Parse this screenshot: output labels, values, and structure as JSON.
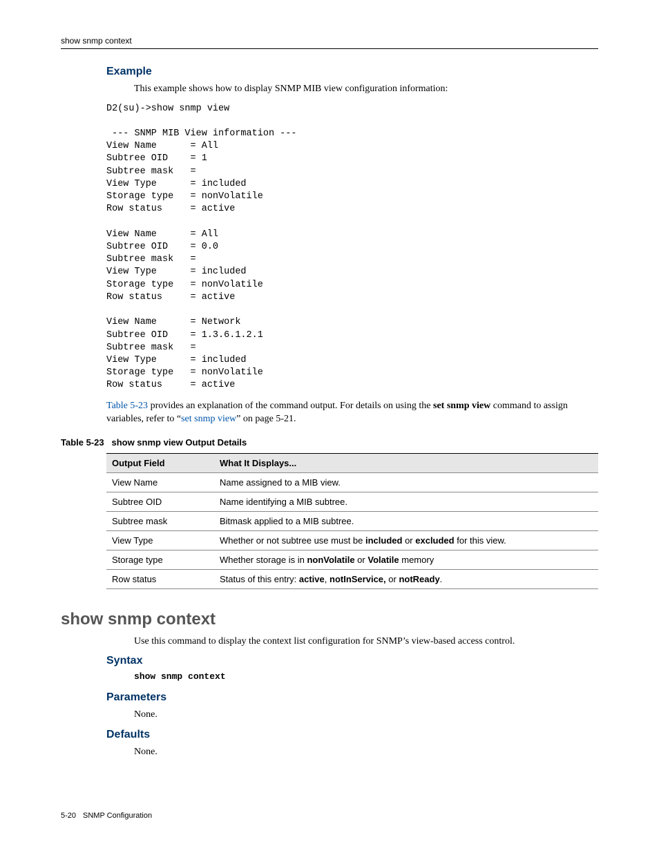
{
  "runningHead": "show snmp context",
  "sections": {
    "example": {
      "heading": "Example",
      "intro": "This example shows how to display SNMP MIB view configuration information:",
      "terminal": "D2(su)->show snmp view\n\n --- SNMP MIB View information ---\nView Name      = All\nSubtree OID    = 1\nSubtree mask   =\nView Type      = included\nStorage type   = nonVolatile\nRow status     = active\n\nView Name      = All\nSubtree OID    = 0.0\nSubtree mask   =\nView Type      = included\nStorage type   = nonVolatile\nRow status     = active\n\nView Name      = Network\nSubtree OID    = 1.3.6.1.2.1\nSubtree mask   =\nView Type      = included\nStorage type   = nonVolatile\nRow status     = active",
      "after_link_ref": "Table 5-23",
      "after_text_1": " provides an explanation of the command output. For details on using the ",
      "after_bold_1": "set snmp view",
      "after_text_2": " command to assign variables, refer to “",
      "after_link_2": "set snmp view",
      "after_text_3": "” on page 5-21."
    },
    "table": {
      "caption_label": "Table 5-23",
      "caption_title": "show snmp view Output Details",
      "head_col1": "Output Field",
      "head_col2": "What It Displays...",
      "rows": [
        {
          "field": "View Name",
          "desc_plain": "Name assigned to a MIB view."
        },
        {
          "field": "Subtree OID",
          "desc_plain": "Name identifying a MIB subtree."
        },
        {
          "field": "Subtree mask",
          "desc_plain": "Bitmask applied to a MIB subtree."
        },
        {
          "field": "View Type",
          "desc_pre": "Whether or not subtree use must be ",
          "b1": "included",
          "mid1": " or ",
          "b2": "excluded",
          "post": " for this view."
        },
        {
          "field": "Storage type",
          "desc_pre": "Whether storage is in ",
          "b1": "nonVolatile",
          "mid1": " or ",
          "b2": "Volatile",
          "post": " memory"
        },
        {
          "field": "Row status",
          "desc_pre": "Status of this entry: ",
          "b1": "active",
          "mid1": ", ",
          "b2": "notInService,",
          "mid2": " or ",
          "b3": "notReady",
          "post": "."
        }
      ]
    },
    "command": {
      "title": "show snmp context",
      "intro": "Use this command to display the context list configuration for SNMP’s view-based access control.",
      "syntax_heading": "Syntax",
      "syntax_text": "show snmp context",
      "parameters_heading": "Parameters",
      "parameters_body": "None.",
      "defaults_heading": "Defaults",
      "defaults_body": "None."
    }
  },
  "footer": {
    "page": "5-20",
    "chapter": "SNMP Configuration"
  }
}
